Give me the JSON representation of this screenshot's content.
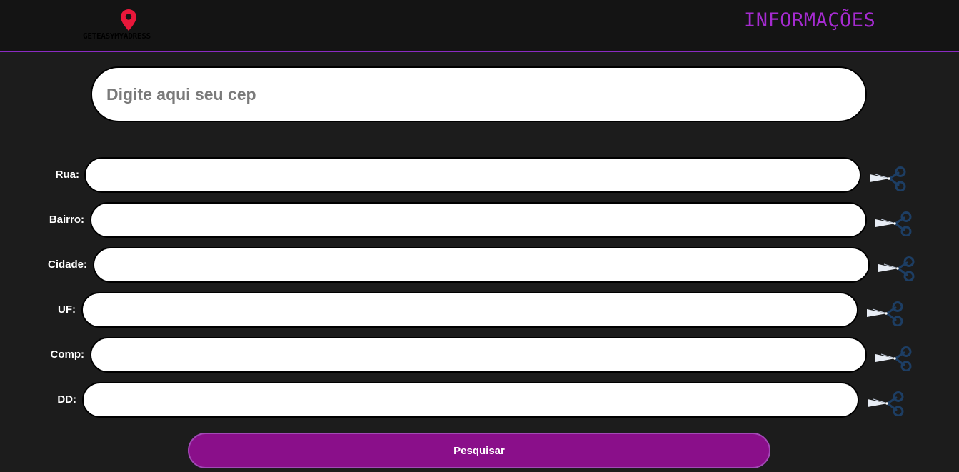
{
  "header": {
    "logo_text": "GETEASYMYADRESS",
    "title": "INFORMAÇÕES"
  },
  "cep": {
    "placeholder": "Digite aqui seu cep",
    "value": ""
  },
  "fields": [
    {
      "label": "Rua:",
      "value": ""
    },
    {
      "label": "Bairro:",
      "value": ""
    },
    {
      "label": "Cidade:",
      "value": ""
    },
    {
      "label": "UF:",
      "value": ""
    },
    {
      "label": "Comp:",
      "value": ""
    },
    {
      "label": "DD:",
      "value": ""
    }
  ],
  "search_button": {
    "label": "Pesquisar"
  },
  "icons": {
    "logo": "map-pin-icon",
    "field_action": "scissors-icon"
  },
  "colors": {
    "accent": "#a52bd0",
    "button": "#8a0f8a",
    "pin": "#e8173a",
    "background": "#1c1c1c",
    "header": "#141414"
  }
}
